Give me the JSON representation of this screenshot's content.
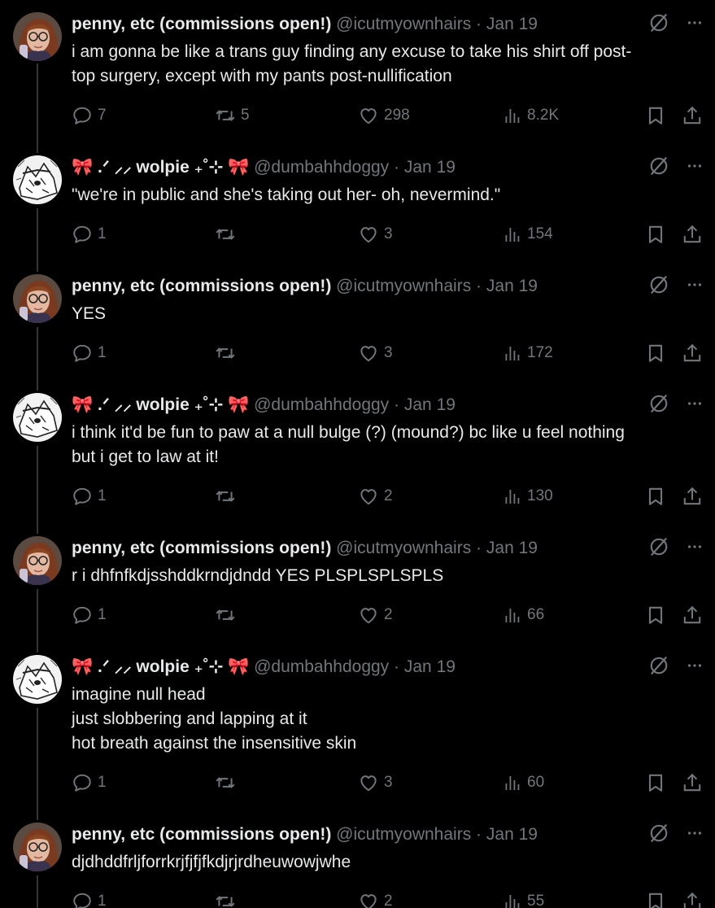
{
  "colors": {
    "background": "#000000",
    "text": "#e7e9ea",
    "muted": "#71767b",
    "thread_line": "#333639"
  },
  "icons": {
    "grok": "slashed-circle-icon",
    "more": "ellipsis-icon",
    "reply": "reply-bubble-icon",
    "repost": "repost-arrows-icon",
    "like": "heart-icon",
    "views": "bar-chart-icon",
    "bookmark": "bookmark-icon",
    "share": "share-icon"
  },
  "tweets": [
    {
      "name": "penny, etc (commissions open!)",
      "handle": "@icutmyownhairs",
      "sep": "·",
      "date": "Jan 19",
      "lines": [
        "i am gonna be like a trans guy finding any excuse to take his shirt off post-",
        "top surgery, except with my pants post-nullification"
      ],
      "replies": "7",
      "reposts": "5",
      "likes": "298",
      "views": "8.2K"
    },
    {
      "name": "🎀 .ᐟ ⸝⸝ wolpie ₊˚⊹ 🎀",
      "handle": "@dumbahhdoggy",
      "sep": "·",
      "date": "Jan 19",
      "lines": [
        "\"we're in public and she's taking out her- oh, nevermind.\""
      ],
      "replies": "1",
      "reposts": "",
      "likes": "3",
      "views": "154"
    },
    {
      "name": "penny, etc (commissions open!)",
      "handle": "@icutmyownhairs",
      "sep": "·",
      "date": "Jan 19",
      "lines": [
        "YES"
      ],
      "replies": "1",
      "reposts": "",
      "likes": "3",
      "views": "172"
    },
    {
      "name": "🎀 .ᐟ ⸝⸝ wolpie ₊˚⊹ 🎀",
      "handle": "@dumbahhdoggy",
      "sep": "·",
      "date": "Jan 19",
      "lines": [
        "i think it'd be fun to paw at a null bulge (?) (mound?) bc like u feel nothing",
        "but i get to law at it!"
      ],
      "replies": "1",
      "reposts": "",
      "likes": "2",
      "views": "130"
    },
    {
      "name": "penny, etc (commissions open!)",
      "handle": "@icutmyownhairs",
      "sep": "·",
      "date": "Jan 19",
      "lines": [
        "r i dhfnfkdjsshddkrndjdndd YES PLSPLSPLSPLS"
      ],
      "replies": "1",
      "reposts": "",
      "likes": "2",
      "views": "66"
    },
    {
      "name": "🎀 .ᐟ ⸝⸝ wolpie ₊˚⊹ 🎀",
      "handle": "@dumbahhdoggy",
      "sep": "·",
      "date": "Jan 19",
      "lines": [
        "imagine null head",
        "just slobbering and lapping at it",
        "hot breath against the insensitive skin"
      ],
      "replies": "1",
      "reposts": "",
      "likes": "3",
      "views": "60"
    },
    {
      "name": "penny, etc (commissions open!)",
      "handle": "@icutmyownhairs",
      "sep": "·",
      "date": "Jan 19",
      "lines": [
        "djdhddfrljforrkrjfjfjfkdjrjrdheuwowjwhe"
      ],
      "replies": "1",
      "reposts": "",
      "likes": "2",
      "views": "55"
    }
  ]
}
